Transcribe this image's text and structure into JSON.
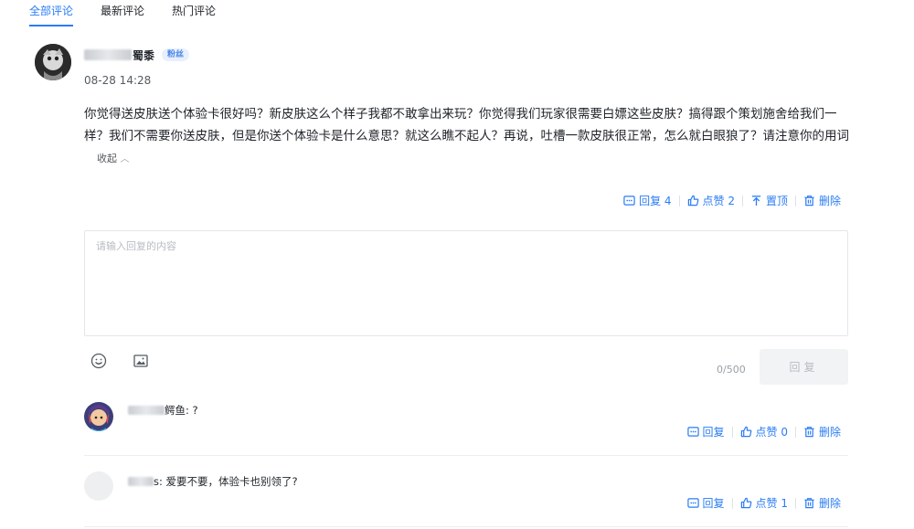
{
  "tabs": [
    {
      "label": "全部评论",
      "active": true
    },
    {
      "label": "最新评论",
      "active": false
    },
    {
      "label": "热门评论",
      "active": false
    }
  ],
  "comment": {
    "author_visible": "蜀黍",
    "badge": "粉丝",
    "time": "08-28 14:28",
    "text": "你觉得送皮肤送个体验卡很好吗？新皮肤这么个样子我都不敢拿出来玩？你觉得我们玩家很需要白嫖这些皮肤？搞得跟个策划施舍给我们一样？我们不需要你送皮肤，但是你送个体验卡是什么意思？就这么瞧不起人？再说，吐槽一款皮肤很正常，怎么就白眼狼了？请注意你的用词",
    "collapse_label": "收起",
    "actions": {
      "reply": "回复 4",
      "like": "点赞 2",
      "pin": "置顶",
      "delete": "删除"
    }
  },
  "reply_box": {
    "placeholder": "请输入回复的内容",
    "counter": "0/500",
    "submit_label": "回复"
  },
  "replies": [
    {
      "author_visible": "鳄鱼",
      "text": ": ?",
      "actions": {
        "reply": "回复",
        "like": "点赞 0",
        "delete": "删除"
      }
    },
    {
      "author_visible": "s",
      "text": ": 爱要不要，体验卡也别领了?",
      "actions": {
        "reply": "回复",
        "like": "点赞 1",
        "delete": "删除"
      }
    }
  ],
  "colors": {
    "accent": "#2a7cf4",
    "text": "#1f2329",
    "muted": "#555a61",
    "border": "#e4e6eb"
  }
}
